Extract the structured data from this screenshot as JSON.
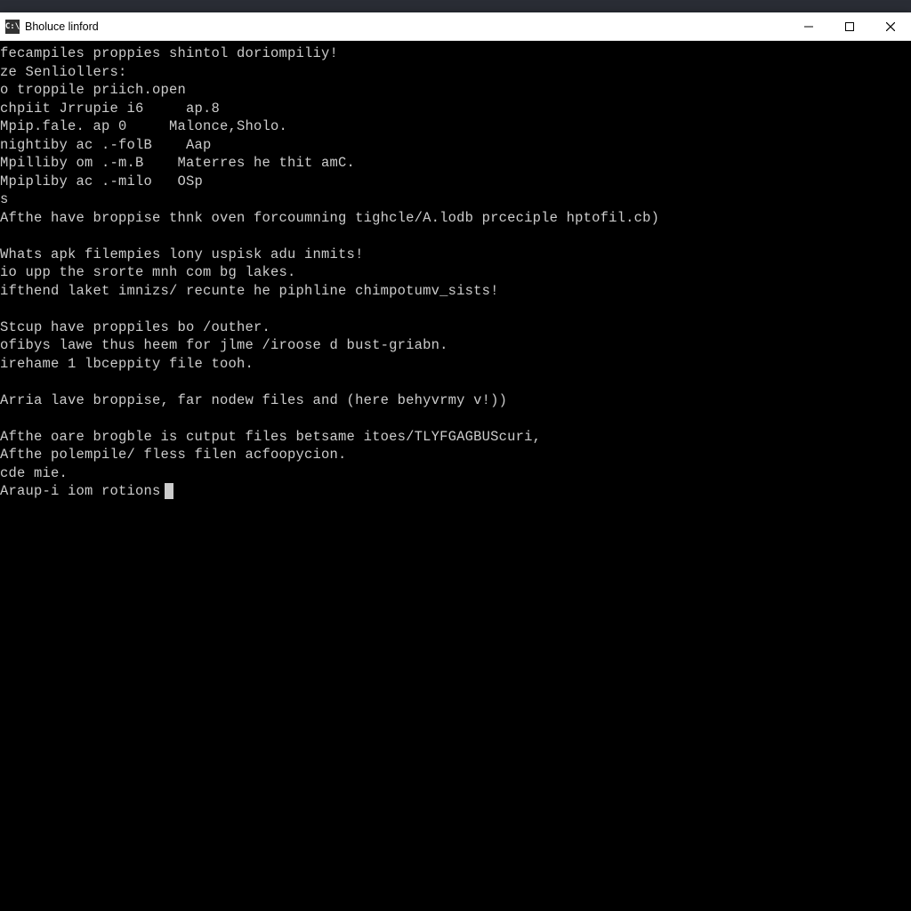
{
  "window": {
    "title": "Bholuce linford",
    "icon_label": "C:\\"
  },
  "terminal": {
    "lines": [
      "fecampiles proppies shintol doriompiliy!",
      "ze Senliollers:",
      "o troppile priich.open",
      "chpiit Jrrupie i6     ap.8",
      "Mpip.fale. ap 0     Malonce,Sholo.",
      "nightiby ac .-folB    Aap",
      "Mpilliby om .-m.B    Materres he thit amC.",
      "Mpipliby ac .-milo   OSp",
      "s",
      "Afthe have broppise thnk oven forcoumning tighcle/A.lodb prceciple hptofil.cb)",
      "",
      "Whats apk filempies lony uspisk adu inmits!",
      "io upp the srorte mnh com bg lakes.",
      "ifthend laket imnizs/ recunte he piphline chimpotumv_sists!",
      "",
      "Stcup have proppiles bo /outher.",
      "ofibys lawe thus heem for jlme /iroose d bust-griabn.",
      "irehame 1 lbceppity file tooh.",
      "",
      "Arria lave broppise, far nodew files and (here behyvrmy v!))",
      "",
      "Afthe oare brogble is cutput files betsame itoes/TLYFGAGBUScuri,",
      "Afthe polempile/ fless filen acfoopycion.",
      "cde mie.",
      "Araup-i iom rotions"
    ],
    "has_cursor": true
  }
}
